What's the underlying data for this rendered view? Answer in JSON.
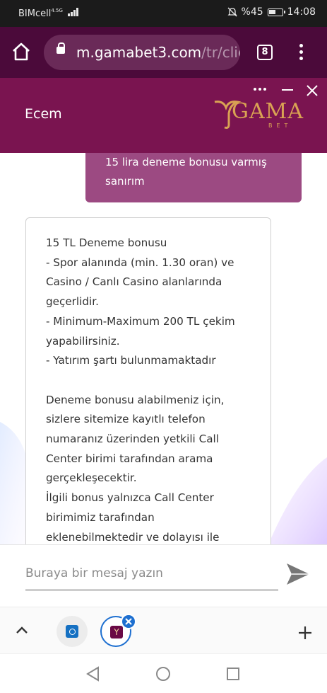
{
  "status_bar": {
    "carrier": "BIMcell",
    "network": "4.5G",
    "battery": "%45",
    "time": "14:08"
  },
  "browser": {
    "url_host": "m.gamabet3.com",
    "url_path": "/tr/clie",
    "tab_count": "8"
  },
  "chat": {
    "agent_name": "Ecem",
    "logo_text": "GAMA",
    "logo_sub": "BET",
    "messages": [
      {
        "from": "user",
        "text": "15 lira deneme bonusu varmış\nsanırım"
      },
      {
        "from": "agent",
        "text": "15 TL Deneme bonusu\n- Spor alanında (min. 1.30 oran) ve\nCasino / Canlı Casino alanlarında\ngeçerlidir.\n- Minimum-Maximum 200 TL çekim\nyapabilirsiniz.\n- Yatırım şartı bulunmamaktadır\n\nDeneme bonusu alabilmeniz için,\nsizlere sitemize kayıtlı telefon\nnumaranız üzerinden yetkili Call\nCenter birimi tarafından arama\ngerçekleşecektir.\nİlgili bonus yalnızca Call Center\nbirimimiz tarafından\neklenebilmektedir ve dolayısı ile"
      }
    ],
    "composer_placeholder": "Buraya bir mesaj yazın"
  },
  "colors": {
    "toolbar": "#4b0a3a",
    "chat_header": "#7a1450",
    "user_bubble": "#9c4a82",
    "logo_gold": "#d9a253"
  }
}
